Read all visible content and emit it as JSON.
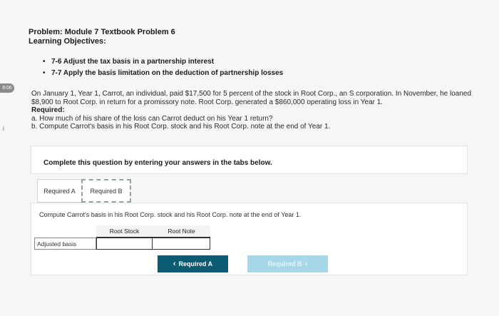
{
  "side": {
    "badge": "8:06",
    "tick": "i"
  },
  "header": {
    "title": "Problem: Module 7 Textbook Problem 6",
    "objectives_label": "Learning Objectives:",
    "objectives": [
      "7-6 Adjust the tax basis in a partnership interest",
      "7-7 Apply the basis limitation on the deduction of partnership losses"
    ]
  },
  "problem": {
    "paragraph": "On January 1, Year 1, Carrot, an individual, paid $17,500 for 5 percent of the stock in Root Corp., an S corporation. In November, he loaned $8,900 to Root Corp. in return for a promissory note. Root Corp. generated a $860,000 operating loss in Year 1.",
    "required_label": "Required:",
    "req_a": "a. How much of his share of the loss can Carrot deduct on his Year 1 return?",
    "req_b": "b. Compute Carrot's basis in his Root Corp. stock and his Root Corp. note at the end of Year 1."
  },
  "card": {
    "text": "Complete this question by entering your answers in the tabs below."
  },
  "tabs": [
    {
      "label": "Required A"
    },
    {
      "label": "Required B"
    }
  ],
  "panel": {
    "instruction": "Compute Carrot's basis in his Root Corp. stock and his Root Corp. note at the end of Year 1.",
    "columns": [
      "Root Stock",
      "Root Note"
    ],
    "row_label": "Adjusted basis",
    "values": [
      "",
      ""
    ]
  },
  "nav": {
    "prev_label": "Required A",
    "prev_icon": "chevron-left-icon",
    "next_label": "Required B",
    "next_icon": "chevron-right-icon"
  },
  "colors": {
    "prev_button": "#0b5c73",
    "next_button_disabled": "#a6d8ea",
    "active_tab_border": "#8fa2a6"
  }
}
